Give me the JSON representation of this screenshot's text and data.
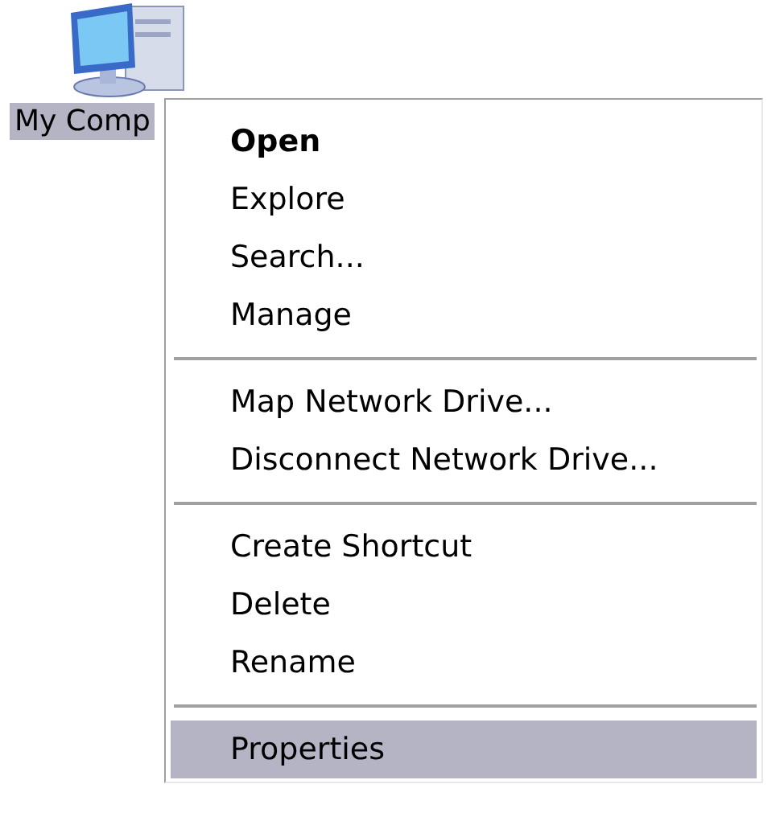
{
  "desktop_icon": {
    "label": "My Comp",
    "selected": true
  },
  "context_menu": {
    "entries": [
      {
        "kind": "item",
        "label": "Open",
        "default": true,
        "selected": false
      },
      {
        "kind": "item",
        "label": "Explore",
        "default": false,
        "selected": false
      },
      {
        "kind": "item",
        "label": "Search...",
        "default": false,
        "selected": false
      },
      {
        "kind": "item",
        "label": "Manage",
        "default": false,
        "selected": false
      },
      {
        "kind": "separator"
      },
      {
        "kind": "item",
        "label": "Map Network Drive...",
        "default": false,
        "selected": false
      },
      {
        "kind": "item",
        "label": "Disconnect Network Drive...",
        "default": false,
        "selected": false
      },
      {
        "kind": "separator"
      },
      {
        "kind": "item",
        "label": "Create Shortcut",
        "default": false,
        "selected": false
      },
      {
        "kind": "item",
        "label": "Delete",
        "default": false,
        "selected": false
      },
      {
        "kind": "item",
        "label": "Rename",
        "default": false,
        "selected": false
      },
      {
        "kind": "separator"
      },
      {
        "kind": "item",
        "label": "Properties",
        "default": false,
        "selected": true
      }
    ]
  }
}
